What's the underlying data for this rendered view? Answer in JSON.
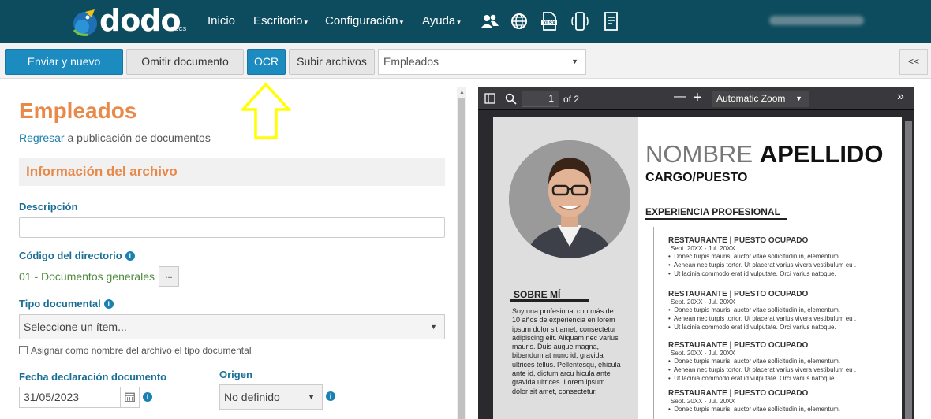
{
  "brand": {
    "name": "dodo",
    "sub": "DOCS"
  },
  "nav": {
    "inicio": "Inicio",
    "escritorio": "Escritorio",
    "configuracion": "Configuración",
    "ayuda": "Ayuda",
    "caret": "▾"
  },
  "toolbar": {
    "send_new": "Enviar y nuevo",
    "skip": "Omitir documento",
    "ocr": "OCR",
    "upload": "Subir archivos",
    "doc_type_selected": "Empleados",
    "collapse": "<<"
  },
  "form": {
    "title": "Empleados",
    "back_link": "Regresar",
    "back_rest": " a publicación de documentos",
    "section_title": "Información del archivo",
    "descripcion_label": "Descripción",
    "descripcion_value": "",
    "codigo_label": "Código del directorio",
    "codigo_value": "01 - Documentos generales",
    "browse_label": "...",
    "tipo_label": "Tipo documental",
    "tipo_placeholder": "Seleccione un ítem...",
    "assign_checkbox_label": "Asignar como nombre del archivo el tipo documental",
    "fecha_label": "Fecha declaración documento",
    "fecha_value": "31/05/2023",
    "origen_label": "Origen",
    "origen_value": "No definido"
  },
  "pdf": {
    "page_current": "1",
    "page_total": "of 2",
    "zoom": "Automatic Zoom"
  },
  "cv": {
    "first_name": "NOMBRE",
    "last_name": "APELLIDO",
    "role": "CARGO/PUESTO",
    "experience_title": "EXPERIENCIA PROFESIONAL",
    "about_title": "SOBRE MÍ",
    "about_text": "Soy una profesional con más de 10 años de experiencia en lorem ipsum dolor sit amet, consectetur adipiscing elit. Aliquam nec varius mauris. Duis augue magna, bibendum at nunc id, gravida ultrices tellus. Pellentesqu, ehicula ante id, dictum arcu hicula ante gravida ultrices. Lorem ipsum dolor sit amet, consectetur.",
    "jobs": [
      {
        "title": "RESTAURANTE | PUESTO OCUPADO",
        "dates": "Sept. 20XX - Jul. 20XX",
        "b1": "Donec turpis mauris, auctor vitae sollicitudin in, elementum.",
        "b2": "Aenean nec turpis tortor. Ut placerat varius vivera vestibulum eu .",
        "b3": "Ut lacinia commodo erat id vulputate. Orci varius natoque."
      },
      {
        "title": "RESTAURANTE | PUESTO OCUPADO",
        "dates": "Sept. 20XX - Jul. 20XX",
        "b1": "Donec turpis mauris, auctor vitae sollicitudin in, elementum.",
        "b2": "Aenean nec turpis tortor. Ut placerat varius vivera vestibulum eu .",
        "b3": "Ut lacinia commodo erat id vulputate. Orci varius natoque."
      },
      {
        "title": "RESTAURANTE | PUESTO OCUPADO",
        "dates": "Sept. 20XX - Jul. 20XX",
        "b1": "Donec turpis mauris, auctor vitae sollicitudin in, elementum.",
        "b2": "Aenean nec turpis tortor. Ut placerat varius vivera vestibulum eu .",
        "b3": "Ut lacinia commodo erat id vulputate. Orci varius natoque."
      },
      {
        "title": "RESTAURANTE | PUESTO OCUPADO",
        "dates": "Sept. 20XX - Jul. 20XX",
        "b1": "Donec turpis mauris, auctor vitae sollicitudin in, elementum."
      }
    ]
  },
  "icons": [
    "users-icon",
    "globe-icon",
    "xlsx-file-icon",
    "mobile-device-icon",
    "document-list-icon",
    "sidebar-toggle-icon",
    "search-icon",
    "calendar-icon",
    "info-icon"
  ],
  "colors": {
    "nav_bg": "#0d4c5f",
    "primary": "#1c8bbf",
    "accent_orange": "#e8894a",
    "label_blue": "#1a6f96",
    "highlight_arrow": "#ffff00"
  }
}
